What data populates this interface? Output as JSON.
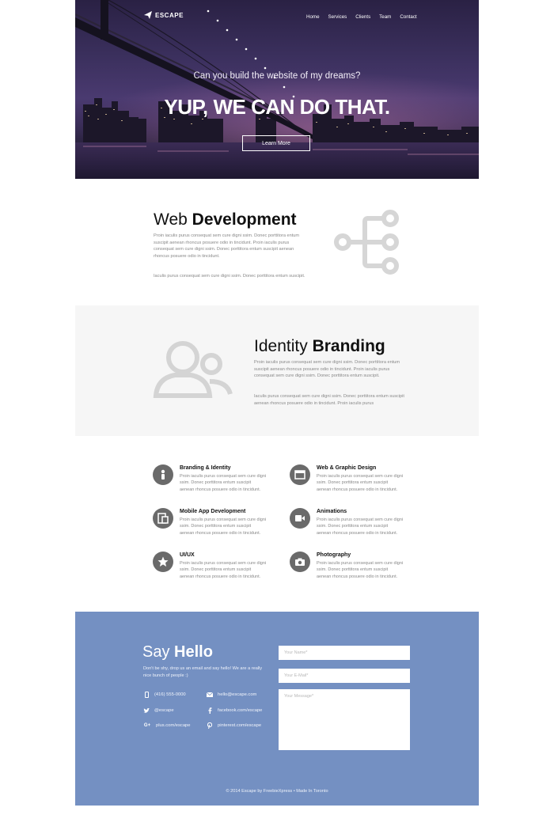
{
  "nav": {
    "logo": "ESCAPE",
    "links": [
      "Home",
      "Services",
      "Clients",
      "Team",
      "Contact"
    ]
  },
  "hero": {
    "subtitle": "Can you build the website of my dreams?",
    "title": "YUP, WE CAN DO THAT.",
    "button": "Learn More"
  },
  "web_dev": {
    "title_light": "Web",
    "title_bold": "Development",
    "para1": "Proin iaculis purus consequat sem cure digni ssim. Donec porttitora entum suscipit aenean rhoncus posuere odio in tincidunt. Proin iaculis purus consequat sem cure digni ssim. Donec porttitora entum suscipit aenean rhoncus posuere odio in tincidunt.",
    "para2": "Iaculis purus consequat sem cure digni ssim. Donec porttitora entum suscipit.",
    "icon": "sitemap-icon"
  },
  "identity": {
    "title_light": "Identity",
    "title_bold": "Branding",
    "para1": "Proin iaculis purus consequat sem cure digni ssim. Donec porttitora entum suscipit aenean rhoncus posuere odio in tincidunt. Proin iaculis purus consequat sem cure digni ssim. Donec porttitora entum suscipit.",
    "para2": "Iaculis purus consequat sem cure digni ssim. Donec porttitora entum suscipit aenean rhoncus posuere odio in tincidunt. Proin iaculis purus",
    "icon": "users-icon"
  },
  "services": [
    {
      "title": "Branding & Identity",
      "desc": "Proin iaculis purus consequat sem cure digni ssim. Donec porttitora entum suscipit aenean rhoncus posuere odio in tincidunt.",
      "icon": "person-icon"
    },
    {
      "title": "Web & Graphic Design",
      "desc": "Proin iaculis purus consequat sem cure digni ssim. Donec porttitora entum suscipit aenean rhoncus posuere odio in tincidunt.",
      "icon": "browser-icon"
    },
    {
      "title": "Mobile App Development",
      "desc": "Proin iaculis purus consequat sem cure digni ssim. Donec porttitora entum suscipit aenean rhoncus posuere odio in tincidunt.",
      "icon": "devices-icon"
    },
    {
      "title": "Animations",
      "desc": "Proin iaculis purus consequat sem cure digni ssim. Donec porttitora entum suscipit aenean rhoncus posuere odio in tincidunt.",
      "icon": "video-icon"
    },
    {
      "title": "UI/UX",
      "desc": "Proin iaculis purus consequat sem cure digni ssim. Donec porttitora entum suscipit aenean rhoncus posuere odio in tincidunt.",
      "icon": "star-icon"
    },
    {
      "title": "Photography",
      "desc": "Proin iaculis purus consequat sem cure digni ssim. Donec porttitora entum suscipit aenean rhoncus posuere odio in tincidunt.",
      "icon": "camera-icon"
    }
  ],
  "contact": {
    "title_light": "Say",
    "title_bold": "Hello",
    "intro": "Don't be shy, drop us an email and say hello! We are a really nice bunch of people :)",
    "phone": "(416) 555-0000",
    "email": "hello@escape.com",
    "twitter": "@escape",
    "facebook": "facebook.com/escape",
    "gplus": "plus.com/escape",
    "pinterest": "pinterest.com/escape",
    "name_placeholder": "Your Name*",
    "email_placeholder": "Your E-Mail*",
    "message_placeholder": "Your Message*",
    "footer": "© 2014 Escape by FreebieXpress • Made In Toronto"
  },
  "colors": {
    "contact_bg": "#7490c2",
    "gray_section": "#f6f6f6",
    "icon_gray": "#6a6a6a"
  }
}
